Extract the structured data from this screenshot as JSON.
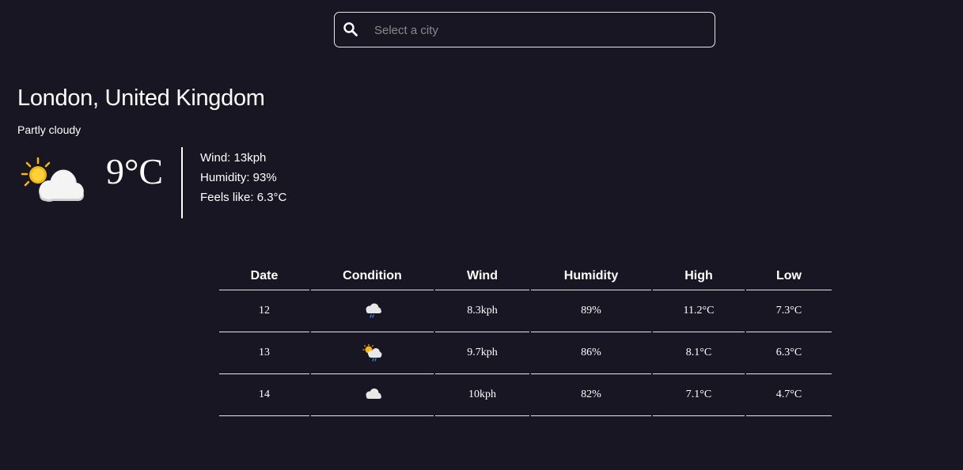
{
  "search": {
    "placeholder": "Select a city",
    "value": ""
  },
  "current": {
    "location": "London, United Kingdom",
    "condition": "Partly cloudy",
    "icon": "partly-cloudy-icon",
    "temperature": "9°C",
    "wind": "Wind: 13kph",
    "humidity": "Humidity: 93%",
    "feels_like": "Feels like: 6.3°C"
  },
  "forecast": {
    "headers": [
      "Date",
      "Condition",
      "Wind",
      "Humidity",
      "High",
      "Low"
    ],
    "rows": [
      {
        "date": "12",
        "icon": "rain-cloud-icon",
        "wind": "8.3kph",
        "humidity": "89%",
        "high": "11.2°C",
        "low": "7.3°C"
      },
      {
        "date": "13",
        "icon": "sun-rain-cloud-icon",
        "wind": "9.7kph",
        "humidity": "86%",
        "high": "8.1°C",
        "low": "6.3°C"
      },
      {
        "date": "14",
        "icon": "cloud-icon",
        "wind": "10kph",
        "humidity": "82%",
        "high": "7.1°C",
        "low": "4.7°C"
      }
    ]
  },
  "colors": {
    "background": "#181622",
    "text": "#ffffff",
    "border": "#e6e6e6",
    "sun": "#f7b718",
    "cloud": "#f2f2f2",
    "rain": "#3b7bd4"
  }
}
